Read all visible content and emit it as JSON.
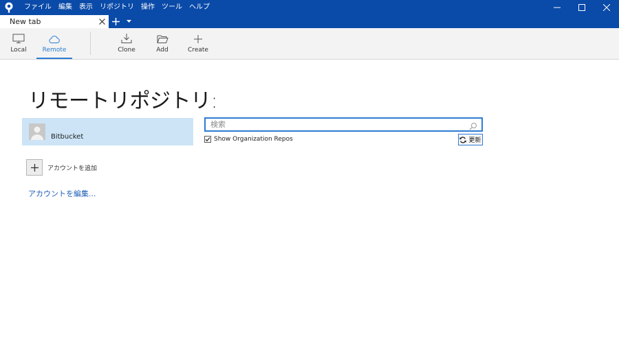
{
  "menu": [
    "ファイル",
    "編集",
    "表示",
    "リポジトリ",
    "操作",
    "ツール",
    "ヘルプ"
  ],
  "tab": {
    "title": "New tab"
  },
  "toolbar": {
    "local": "Local",
    "remote": "Remote",
    "clone": "Clone",
    "add": "Add",
    "create": "Create"
  },
  "main": {
    "title": "リモートリポジトリ:",
    "account": {
      "name": "Bitbucket"
    },
    "add_account": "アカウントを追加",
    "edit_accounts": "アカウントを編集...",
    "search_placeholder": "検索",
    "show_org_repos": "Show Organization Repos",
    "show_org_repos_checked": true,
    "refresh": "更新"
  },
  "colors": {
    "titlebar": "#0a4aa8",
    "accent": "#2b7cd3",
    "selected_row": "#cce4f6"
  }
}
